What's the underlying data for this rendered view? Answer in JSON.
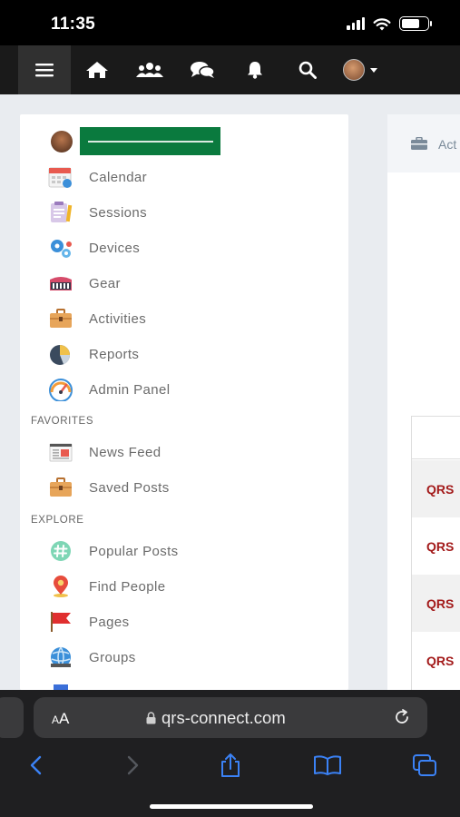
{
  "status_bar": {
    "time": "11:35"
  },
  "top_nav": {
    "items": [
      "menu-icon",
      "home-icon",
      "users-icon",
      "chat-icon",
      "bell-icon",
      "search-icon",
      "avatar"
    ]
  },
  "sidebar": {
    "menu": [
      {
        "label": "Calendar",
        "icon": "calendar-icon"
      },
      {
        "label": "Sessions",
        "icon": "sessions-icon"
      },
      {
        "label": "Devices",
        "icon": "gears-icon"
      },
      {
        "label": "Gear",
        "icon": "keyboard-icon"
      },
      {
        "label": "Activities",
        "icon": "briefcase-icon"
      },
      {
        "label": "Reports",
        "icon": "pie-chart-icon"
      },
      {
        "label": "Admin Panel",
        "icon": "gauge-icon"
      }
    ],
    "favorites_header": "FAVORITES",
    "favorites": [
      {
        "label": "News Feed",
        "icon": "newspaper-icon"
      },
      {
        "label": "Saved Posts",
        "icon": "briefcase-icon"
      }
    ],
    "explore_header": "EXPLORE",
    "explore": [
      {
        "label": "Popular Posts",
        "icon": "hashtag-icon"
      },
      {
        "label": "Find People",
        "icon": "map-pin-icon"
      },
      {
        "label": "Pages",
        "icon": "flag-icon"
      },
      {
        "label": "Groups",
        "icon": "globe-icon"
      }
    ]
  },
  "right_panel": {
    "header_label": "Act",
    "rows": [
      "QRS",
      "QRS",
      "QRS",
      "QRS"
    ]
  },
  "browser": {
    "aa_label_small": "A",
    "aa_label_big": "A",
    "url": "qrs-connect.com"
  },
  "colors": {
    "accent_green": "#0a7a3e",
    "link_red": "#a31a1a",
    "ios_blue": "#3b82f6"
  }
}
